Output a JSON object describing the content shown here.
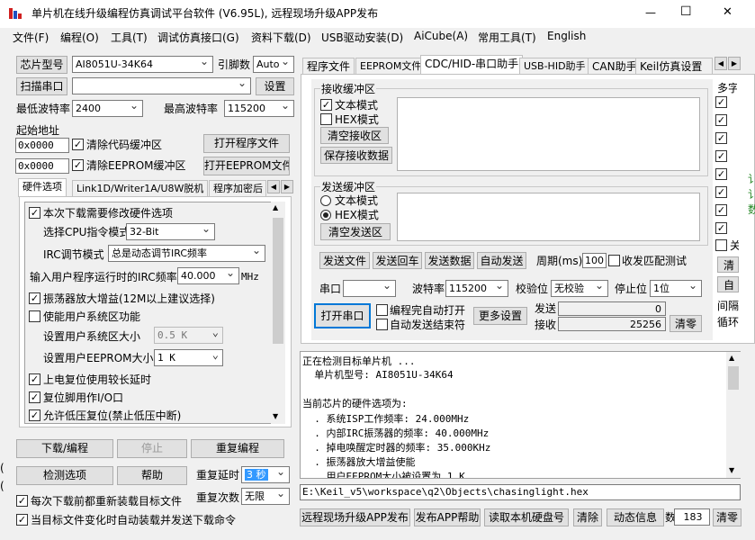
{
  "window": {
    "title": "单片机在线升级编程仿真调试平台软件 (V6.95L), 远程现场升级APP发布",
    "min": "—",
    "max": "☐",
    "close": "✕"
  },
  "menu": [
    "文件(F)",
    "编程(O)",
    "工具(T)",
    "调试仿真接口(G)",
    "资料下载(D)",
    "USB驱动安装(D)",
    "AiCube(A)",
    "常用工具(T)",
    "English"
  ],
  "left": {
    "chip_label": "芯片型号",
    "chip_value": "AI8051U-34K64",
    "pins_label": "引脚数",
    "pins_value": "Auto",
    "scan_port": "扫描串口",
    "port_value": "",
    "settings": "设置",
    "min_baud_label": "最低波特率",
    "min_baud": "2400",
    "max_baud_label": "最高波特率",
    "max_baud": "115200",
    "start_addr_label": "起始地址",
    "addr1": "0x0000",
    "clear_code": "清除代码缓冲区",
    "open_prog": "打开程序文件",
    "addr2": "0x0000",
    "clear_eeprom": "清除EEPROM缓冲区",
    "open_eeprom": "打开EEPROM文件",
    "tabs": [
      "硬件选项",
      "Link1D/Writer1A/U8W脱机",
      "程序加密后"
    ],
    "hw": {
      "modify_on_download": "本次下载需要修改硬件选项",
      "cpu_mode_label": "选择CPU指令模式",
      "cpu_mode": "32-Bit",
      "irc_mode_label": "IRC调节模式",
      "irc_mode": "总是动态调节IRC频率",
      "irc_freq_label": "输入用户程序运行时的IRC频率",
      "irc_freq": "40.000",
      "irc_unit": "MHz",
      "osc_gain": "振荡器放大增益(12M以上建议选择)",
      "user_sys_area": "使能用户系统区功能",
      "sys_area_size_label": "设置用户系统区大小",
      "sys_area_size": "0.5 K",
      "eeprom_size_label": "设置用户EEPROM大小",
      "eeprom_size": "1   K",
      "long_reset": "上电复位使用较长延时",
      "reset_io": "复位脚用作I/O口",
      "low_volt": "允许低压复位(禁止低压中断)"
    },
    "download": "下载/编程",
    "stop": "停止",
    "reprogram": "重复编程",
    "check_options": "检测选项",
    "help": "帮助",
    "repeat_delay_label": "重复延时",
    "repeat_delay": "3 秒",
    "repeat_count_label": "重复次数",
    "repeat_count": "无限",
    "reload_before": "每次下载前都重新装载目标文件",
    "auto_load": "当目标文件变化时自动装载并发送下载命令"
  },
  "right": {
    "tabs": [
      "程序文件",
      "EEPROM文件",
      "CDC/HID-串口助手",
      "USB-HID助手",
      "CAN助手",
      "Keil仿真设置"
    ],
    "recv_group": "接收缓冲区",
    "recv_text_mode": "文本模式",
    "recv_hex_mode": "HEX模式",
    "clear_recv": "清空接收区",
    "save_recv": "保存接收数据",
    "send_group": "发送缓冲区",
    "send_text_mode": "文本模式",
    "send_hex_mode": "HEX模式",
    "clear_send": "清空发送区",
    "send_file": "发送文件",
    "send_return": "发送回车",
    "send_data": "发送数据",
    "auto_send": "自动发送",
    "period_label": "周期(ms)",
    "period": "100",
    "match_recv": "收发匹配测试",
    "multi_label": "多字",
    "side_labels": [
      "关",
      "清",
      "自",
      "间隔",
      "循环"
    ],
    "port_label": "串口",
    "port_value": "",
    "baud_label": "波特率",
    "baud_value": "115200",
    "parity_label": "校验位",
    "parity_value": "无校验",
    "stop_label": "停止位",
    "stop_value": "1位",
    "open_port": "打开串口",
    "auto_open": "编程完自动打开",
    "auto_send_end": "自动发送结束符",
    "more_settings": "更多设置",
    "send_count_label": "发送",
    "send_count": "0",
    "recv_count_label": "接收",
    "recv_count": "25256",
    "clear_count": "清零"
  },
  "log": [
    "正在检测目标单片机 ...",
    "  单片机型号: AI8051U-34K64",
    "",
    "当前芯片的硬件选项为:",
    "  . 系统ISP工作频率: 24.000MHz",
    "  . 内部IRC振荡器的频率: 40.000MHz",
    "  . 掉电唤醒定时器的频率: 35.000KHz",
    "  . 振荡器放大增益使能",
    "  . 用户EEPROM大小被设置为 1 K"
  ],
  "file_path": "E:\\Keil_v5\\workspace\\q2\\Objects\\chasinglight.hex",
  "bottom": {
    "publish": "远程现场升级APP发布",
    "publish_help": "发布APP帮助",
    "read_disk": "读取本机硬盘号",
    "clear": "清除",
    "dyn_info": "动态信息",
    "counter_label": "数",
    "counter": "183",
    "clear2": "清零"
  },
  "edge_text": [
    "讠",
    "讠",
    "数"
  ],
  "colors": {
    "accent": "#0078d7",
    "selected": "#3399ff"
  }
}
